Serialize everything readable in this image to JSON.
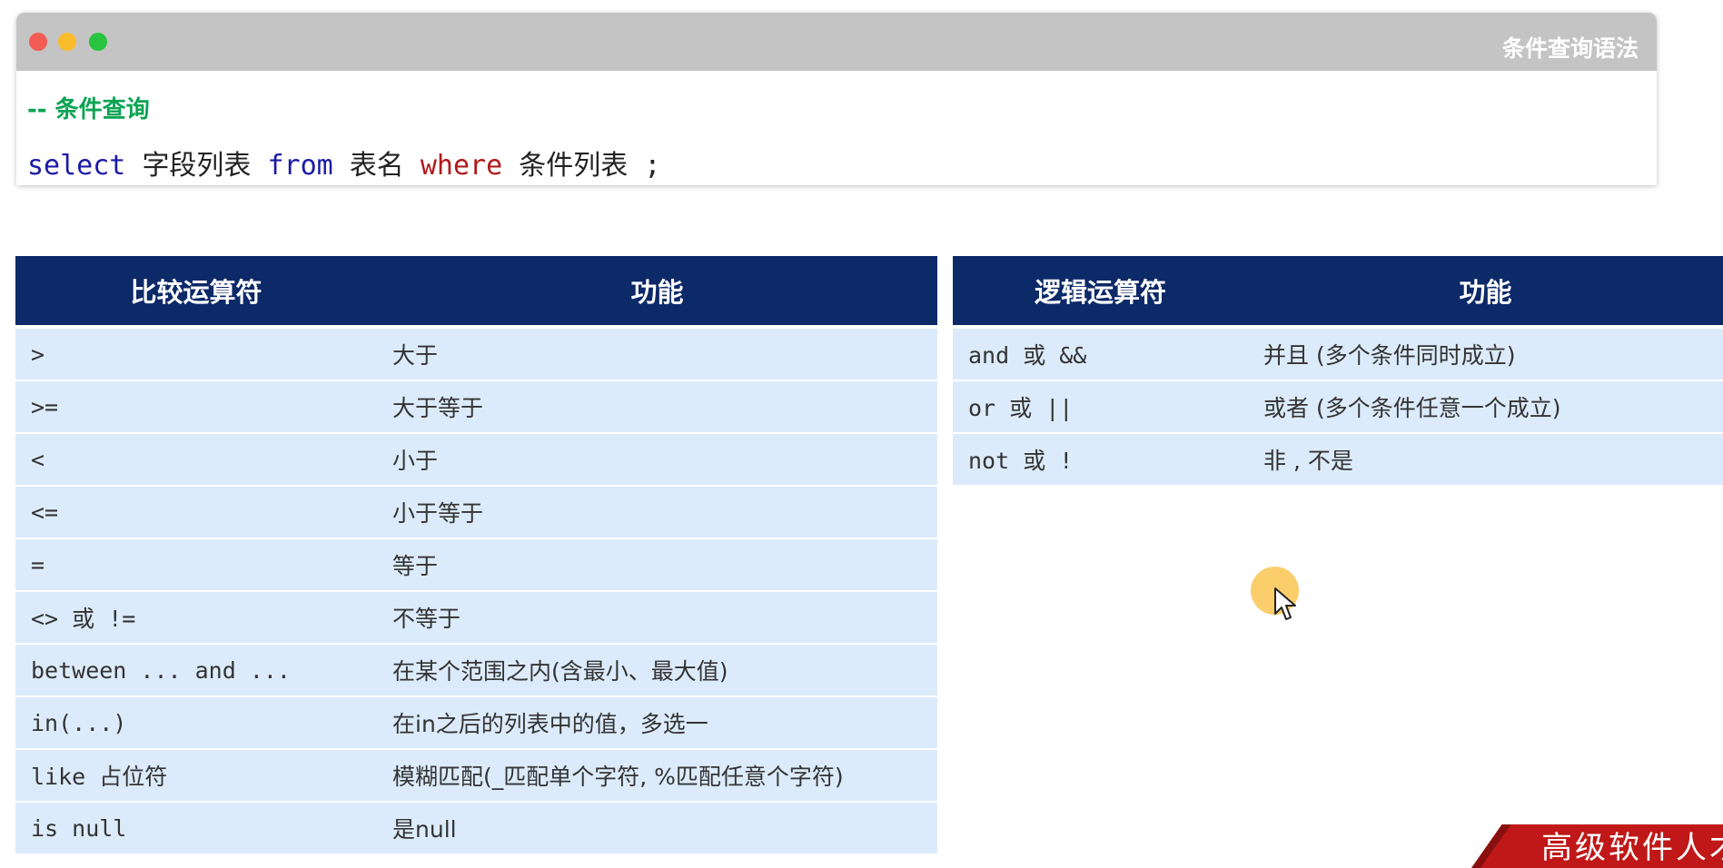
{
  "window": {
    "title": "条件查询语法",
    "comment": "-- 条件查询",
    "sql": {
      "select_kw": "select",
      "fields": "字段列表",
      "from_kw": "from",
      "table": "表名",
      "where_kw": "where",
      "conditions": "条件列表",
      "terminator": ";"
    }
  },
  "comparison_table": {
    "headers": [
      "比较运算符",
      "功能"
    ],
    "rows": [
      [
        ">",
        "大于"
      ],
      [
        ">=",
        "大于等于"
      ],
      [
        "<",
        "小于"
      ],
      [
        "<=",
        "小于等于"
      ],
      [
        "=",
        "等于"
      ],
      [
        "<>  或 !=",
        "不等于"
      ],
      [
        "between ... and ...",
        "在某个范围之内(含最小、最大值)"
      ],
      [
        "in(...)",
        "在in之后的列表中的值，多选一"
      ],
      [
        "like  占位符",
        "模糊匹配(_匹配单个字符, %匹配任意个字符)"
      ],
      [
        "is null",
        "是null"
      ]
    ]
  },
  "logic_table": {
    "headers": [
      "逻辑运算符",
      "功能"
    ],
    "rows": [
      [
        "and  或  &&",
        "并且 (多个条件同时成立)"
      ],
      [
        "or  或  ||",
        "或者 (多个条件任意一个成立)"
      ],
      [
        "not  或  !",
        "非 , 不是"
      ]
    ]
  },
  "watermark": {
    "text": "高级软件人才"
  },
  "colors": {
    "header_bg": "#0c2968",
    "row_bg": "#dcebfb",
    "comment": "#0ba353",
    "keyword": "#1a1aa6",
    "keyword_where": "#b01a1a",
    "cursor_highlight": "#fac95a"
  },
  "icons": {
    "window_buttons": [
      "close-dot",
      "minimize-dot",
      "maximize-dot"
    ],
    "cursor": "mouse-pointer-icon"
  }
}
